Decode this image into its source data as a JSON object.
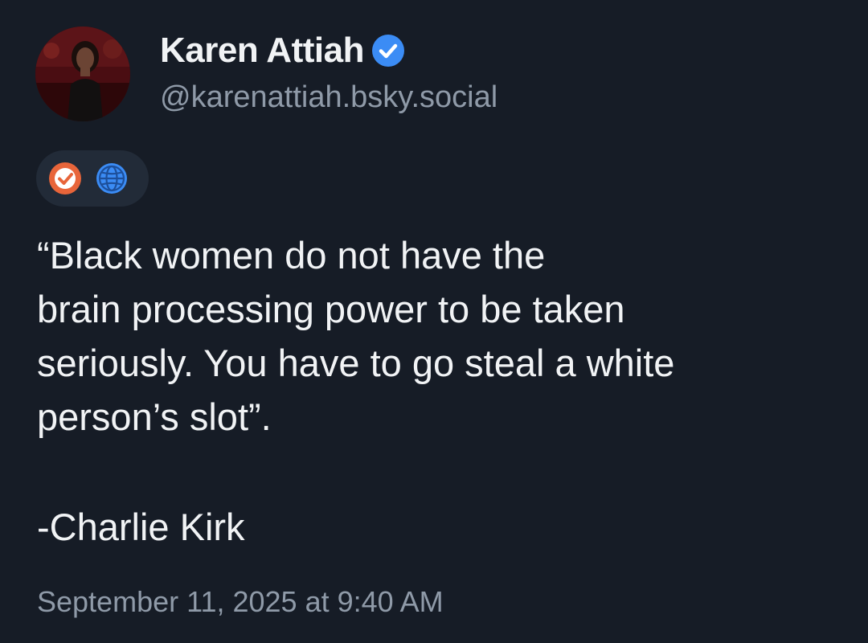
{
  "author": {
    "display_name": "Karen Attiah",
    "handle": "@karenattiah.bsky.social",
    "verified": true
  },
  "badges": [
    {
      "icon": "checkmark-badge-icon",
      "color": "#e8653a"
    },
    {
      "icon": "globe-icon",
      "color": "#3b8cf5"
    }
  ],
  "post": {
    "lines": [
      "“Black women do not have the",
      "brain processing power to be taken",
      "seriously. You have to go steal a white",
      "person’s slot”."
    ],
    "attribution": "-Charlie Kirk",
    "timestamp": "September 11, 2025 at 9:40 AM"
  },
  "colors": {
    "background": "#161c26",
    "text": "#f1f3f5",
    "muted": "#8f9aa8",
    "verified": "#3b8cf5"
  }
}
